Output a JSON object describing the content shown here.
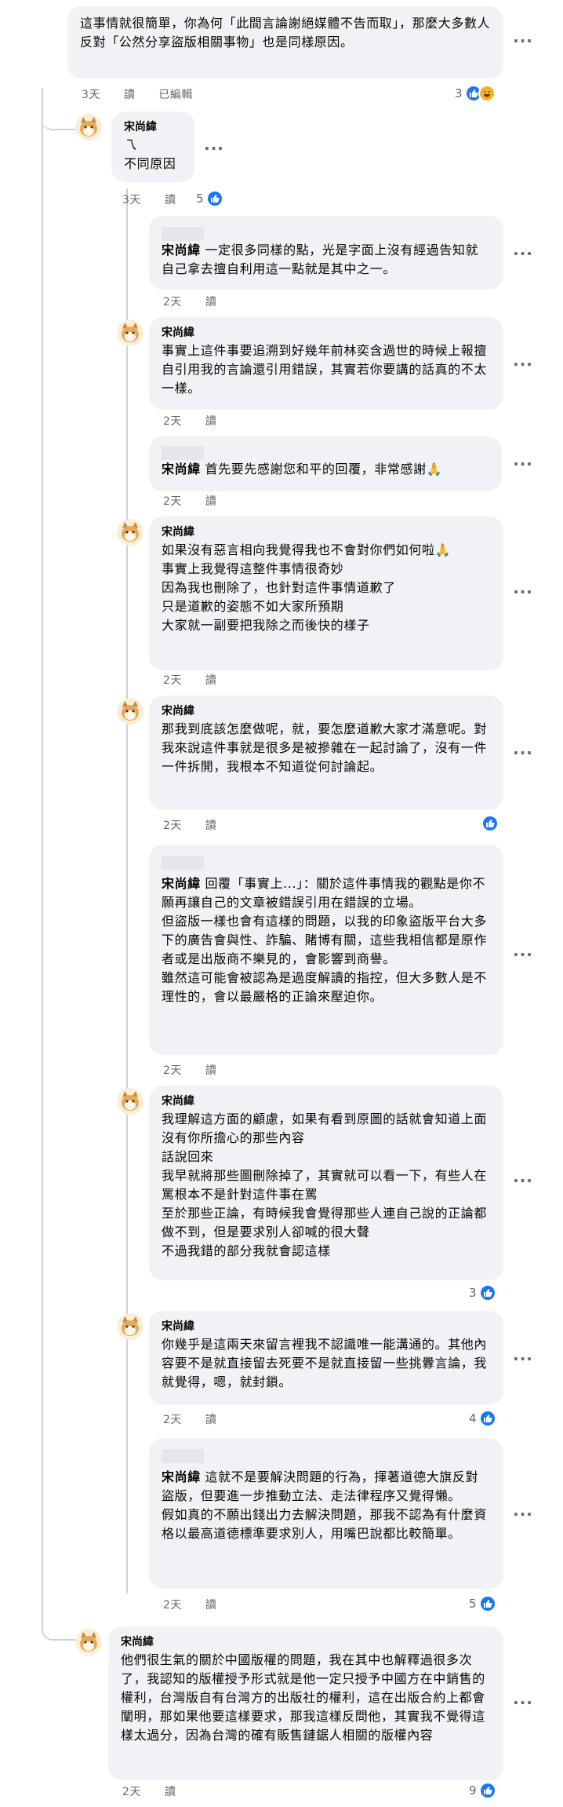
{
  "colors": {
    "bubble": "#f0f2f5",
    "meta": "#65676b",
    "like": "#1877f2",
    "thread": "#ced0d4"
  },
  "top": {
    "text": "這事情就很簡單，你為何「此間言論謝絕媒體不告而取」，那麼大多數人反對「公然分享盜版相關事物」也是同樣原因。",
    "time": "3天",
    "reply": "讀",
    "edited": "已編輯",
    "count": "3"
  },
  "c1": {
    "author": "宋尚緯",
    "text": "乁\n不同原因",
    "time": "3天",
    "reply": "讀",
    "count": "5"
  },
  "r1": {
    "author": "宋尚緯",
    "text": "一定很多同樣的點，光是字面上沒有經過告知就自己拿去擅自利用這一點就是其中之一。",
    "time": "2天",
    "reply": "讀"
  },
  "r2": {
    "author": "宋尚緯",
    "text": "事實上這件事要追溯到好幾年前林奕含過世的時候上報擅自引用我的言論還引用錯誤，其實若你要講的話真的不太一樣。",
    "time": "2天",
    "reply": "讀"
  },
  "r3": {
    "author": "宋尚緯",
    "text": "首先要先感謝您和平的回覆，非常感謝🙏",
    "time": "2天",
    "reply": "讀"
  },
  "r4": {
    "author": "宋尚緯",
    "text": "如果沒有惡言相向我覺得我也不會對你們如何啦🙏\n事實上我覺得這整件事情很奇妙\n因為我也刪除了，也針對這件事情道歉了\n只是道歉的姿態不如大家所預期\n大家就一副要把我除之而後快的樣子",
    "time": "2天",
    "reply": "讀"
  },
  "r5": {
    "author": "宋尚緯",
    "text": "那我到底該怎麼做呢，就，要怎麼道歉大家才滿意呢。對我來說這件事就是很多是被摻雜在一起討論了，沒有一件一件拆開，我根本不知道從何討論起。",
    "time": "2天",
    "reply": "讀"
  },
  "r6": {
    "author": "宋尚緯",
    "text": "回覆「事實上...」：關於這件事情我的觀點是你不願再讓自己的文章被錯誤引用在錯誤的立場。\n但盜版一樣也會有這樣的問題，以我的印象盜版平台大多下的廣告會與性、詐騙、賭博有關，這些我相信都是原作者或是出版商不樂見的，會影響到商譽。\n雖然這可能會被認為是過度解讀的指控，但大多數人是不理性的，會以最嚴格的正論來壓迫你。",
    "time": "2天",
    "reply": "讀"
  },
  "r7": {
    "author": "宋尚緯",
    "text": "我理解這方面的顧慮，如果有看到原圖的話就會知道上面沒有你所擔心的那些內容\n話說回來\n我早就將那些圖刪除掉了，其實就可以看一下，有些人在罵根本不是針對這件事在罵\n至於那些正論，有時候我會覺得那些人連自己說的正論都做不到，但是要求別人卻喊的很大聲\n不過我錯的部分我就會認這樣",
    "time": "",
    "reply": "",
    "count": "3"
  },
  "r8": {
    "author": "宋尚緯",
    "text": "你幾乎是這兩天來留言裡我不認識唯一能溝通的。其他內容要不是就直接留去死要不是就直接留一些挑釁言論，我就覺得，嗯，就封鎖。",
    "time": "2天",
    "reply": "讀",
    "count": "4"
  },
  "r9": {
    "author": "宋尚緯",
    "text": "這就不是要解決問題的行為，揮著道德大旗反對盜版，但要進一步推動立法、走法律程序又覺得懶。\n假如真的不願出錢出力去解決問題，那我不認為有什麼資格以最高道德標準要求別人，用嘴巴說都比較簡單。",
    "time": "2天",
    "reply": "讀",
    "count": "5"
  },
  "c2": {
    "author": "宋尚緯",
    "text": "他們很生氣的關於中國版權的問題，我在其中也解釋過很多次了，我認知的版權授予形式就是他一定只授予中國方在中銷售的權利，台灣版自有台灣方的出版社的權利，這在出版合約上都會闡明，那如果他要這樣要求，那我這樣反問他，其實我不覺得這樣太過分，因為台灣的確有販售鏈鋸人相關的版權內容",
    "time": "2天",
    "reply": "讀",
    "count": "9"
  }
}
